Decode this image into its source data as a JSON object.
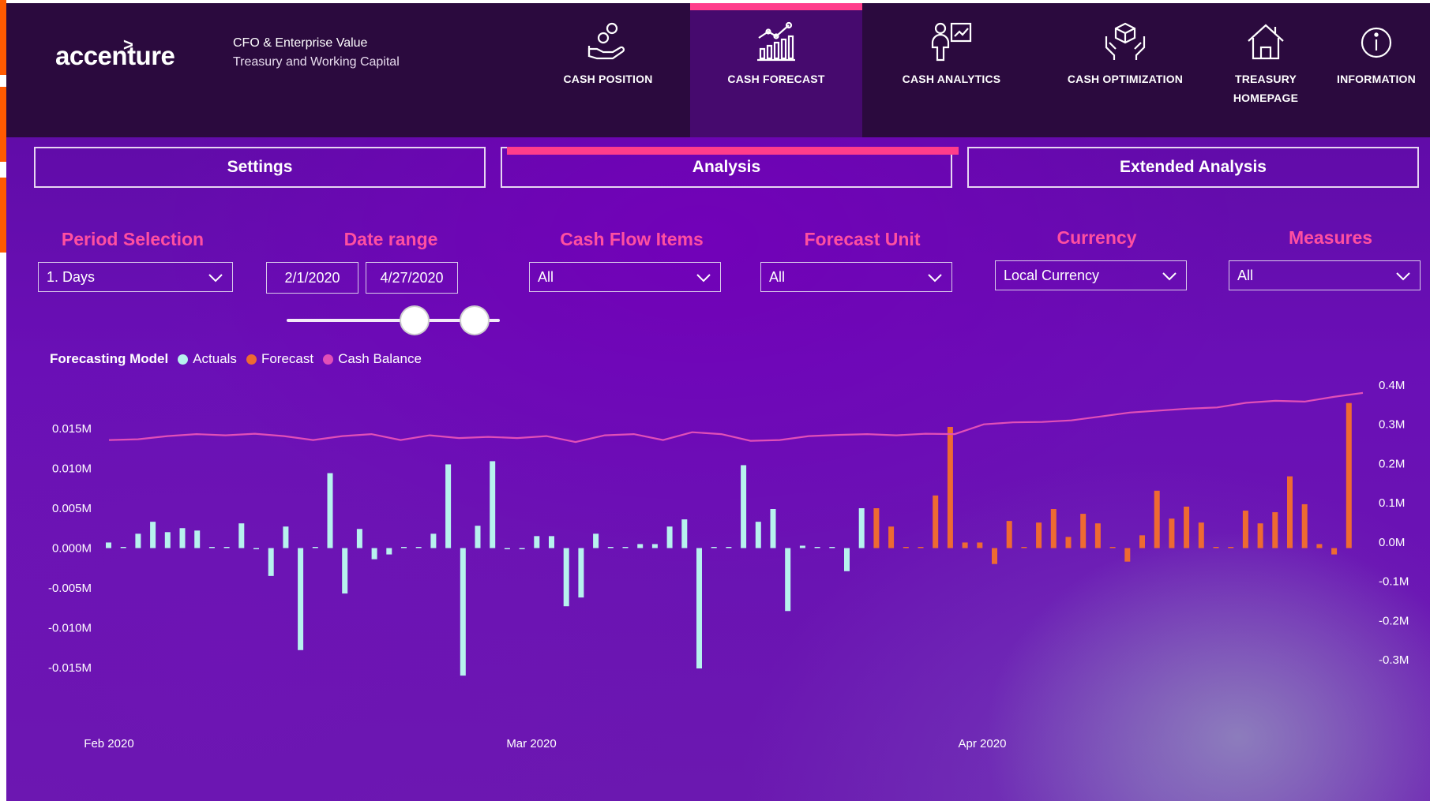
{
  "brand": {
    "logo_text": "accenture",
    "logo_mark": ">",
    "subtitle_line1": "CFO & Enterprise Value",
    "subtitle_line2": "Treasury and Working Capital"
  },
  "nav": [
    {
      "label": "CASH POSITION",
      "icon": "hand-coin-icon",
      "active": false
    },
    {
      "label": "CASH FORECAST",
      "icon": "line-chart-icon",
      "active": true
    },
    {
      "label": "CASH ANALYTICS",
      "icon": "analytics-person-icon",
      "active": false
    },
    {
      "label": "CASH OPTIMIZATION",
      "icon": "hands-cube-icon",
      "active": false
    },
    {
      "label_line1": "TREASURY",
      "label_line2": "HOMEPAGE",
      "icon": "home-icon",
      "active": false
    },
    {
      "label": "INFORMATION",
      "icon": "info-icon",
      "active": false
    }
  ],
  "tabs": [
    {
      "label": "Settings",
      "active": false
    },
    {
      "label": "Analysis",
      "active": true
    },
    {
      "label": "Extended Analysis",
      "active": false
    }
  ],
  "filters": {
    "period": {
      "title": "Period Selection",
      "value": "1. Days"
    },
    "date_range": {
      "title": "Date range",
      "start": "2/1/2020",
      "end": "4/27/2020",
      "slider_start": 0.6,
      "slider_end": 0.88
    },
    "cash_flow_items": {
      "title": "Cash Flow Items",
      "value": "All"
    },
    "forecast_unit": {
      "title": "Forecast Unit",
      "value": "All"
    },
    "currency": {
      "title": "Currency",
      "value": "Local Currency"
    },
    "measures": {
      "title": "Measures",
      "value": "All"
    }
  },
  "legend": {
    "title": "Forecasting Model",
    "items": [
      {
        "label": "Actuals",
        "color": "#b7f2ee"
      },
      {
        "label": "Forecast",
        "color": "#ee6a32"
      },
      {
        "label": "Cash Balance",
        "color": "#e24fb7"
      }
    ]
  },
  "chart_data": {
    "type": "bar",
    "title": "Forecasting Model",
    "x_start": "2020-02-01",
    "x_end": "2020-04-27",
    "x_tick_labels": [
      "Feb 2020",
      "Mar 2020",
      "Apr 2020"
    ],
    "y_left": {
      "ylim": [
        -0.015,
        0.015
      ],
      "unit": "M",
      "tick_labels": [
        "0.015M",
        "0.010M",
        "0.005M",
        "0.000M",
        "-0.005M",
        "-0.010M",
        "-0.015M"
      ]
    },
    "y_right": {
      "ylim": [
        -0.3,
        0.4
      ],
      "unit": "M",
      "tick_labels": [
        "0.4M",
        "0.3M",
        "0.2M",
        "0.1M",
        "0.0M",
        "-0.1M",
        "-0.2M",
        "-0.3M"
      ]
    },
    "grid": false,
    "legend_position": "top-left",
    "series": [
      {
        "name": "Actuals",
        "color": "#b7f2ee",
        "axis": "left",
        "values": [
          0.0007,
          0,
          0.0018,
          0.0033,
          0.002,
          0.0025,
          0.0022,
          0,
          0,
          0.0031,
          -0.0001,
          -0.0035,
          0.0027,
          -0.0128,
          0,
          0.0094,
          -0.0057,
          0.0024,
          -0.0014,
          -0.0008,
          0,
          0,
          0.0018,
          0.0105,
          -0.016,
          0.0028,
          0.0109,
          -0.0001,
          -0.0001,
          0.0015,
          0.0015,
          -0.0073,
          -0.0062,
          0.0018,
          0,
          0,
          0.0005,
          0.0005,
          0.0027,
          0.0036,
          -0.0151,
          0,
          0,
          0.0104,
          0.0033,
          0.0049,
          -0.0079,
          0.0003,
          0,
          0,
          -0.0029,
          0.005
        ]
      },
      {
        "name": "Forecast",
        "color": "#ee6a32",
        "axis": "left",
        "values": [
          0.005,
          0.0027,
          0.0001,
          0.0001,
          0.0066,
          0.0152,
          0.0007,
          0.0007,
          -0.002,
          0.0034,
          0.0001,
          0.0032,
          0.0049,
          0.0014,
          0.0043,
          0.0031,
          0.0001,
          -0.0017,
          0.0016,
          0.0072,
          0.0037,
          0.0052,
          0.0032,
          0.0001,
          0.0001,
          0.0047,
          0.0031,
          0.0045,
          0.009,
          0.0055,
          0.0005,
          -0.0008,
          0.0182
        ]
      },
      {
        "name": "Cash Balance",
        "color": "#e24fb7",
        "axis": "right",
        "values": [
          0.26,
          0.262,
          0.27,
          0.275,
          0.272,
          0.276,
          0.27,
          0.26,
          0.27,
          0.275,
          0.26,
          0.272,
          0.265,
          0.268,
          0.265,
          0.27,
          0.255,
          0.272,
          0.275,
          0.26,
          0.28,
          0.275,
          0.258,
          0.26,
          0.27,
          0.273,
          0.275,
          0.272,
          0.276,
          0.275,
          0.3,
          0.305,
          0.306,
          0.31,
          0.32,
          0.33,
          0.335,
          0.34,
          0.343,
          0.355,
          0.36,
          0.358,
          0.37,
          0.38
        ]
      }
    ]
  }
}
